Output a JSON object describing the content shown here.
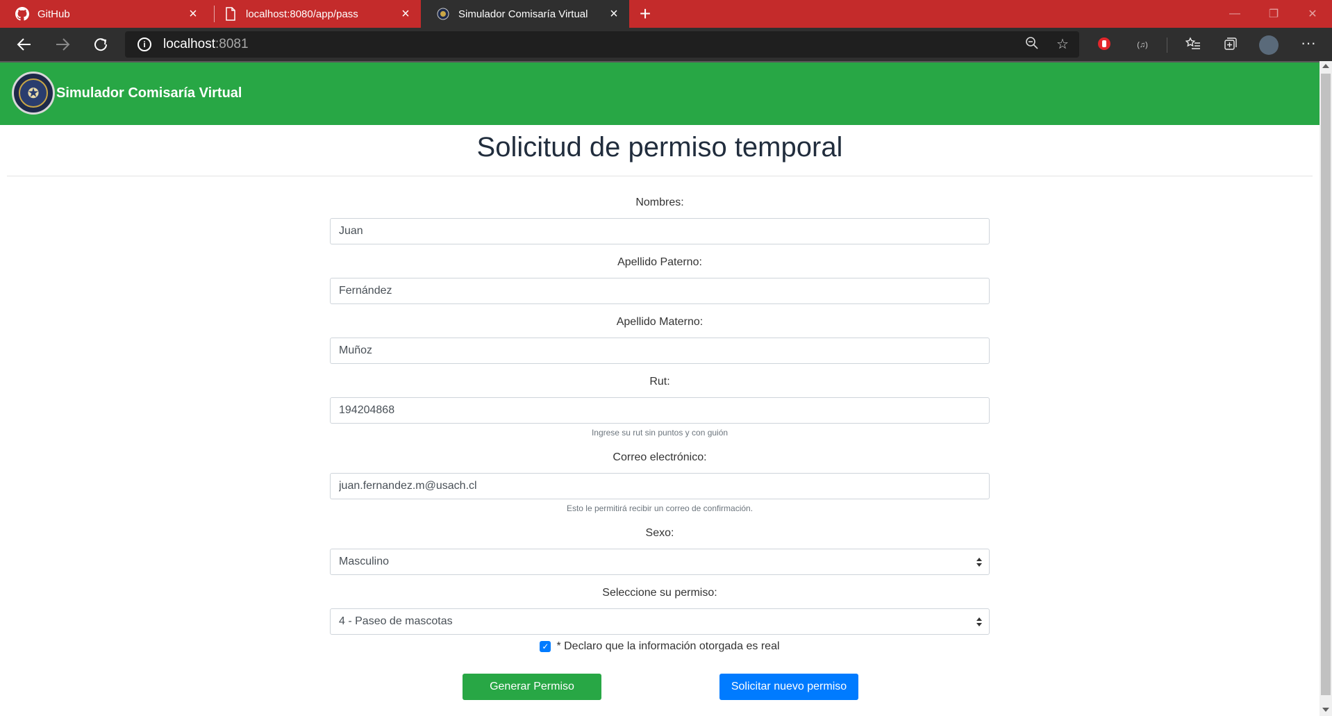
{
  "browser": {
    "tabs": [
      {
        "title": "GitHub",
        "icon": "github-icon",
        "active": false
      },
      {
        "title": "localhost:8080/app/pass",
        "icon": "page-icon",
        "active": false
      },
      {
        "title": "Simulador Comisaría Virtual",
        "icon": "site-favicon",
        "active": true
      }
    ],
    "address": {
      "host": "localhost",
      "port": ":8081"
    },
    "theme_color": "#c42b2b"
  },
  "site": {
    "brand": "Simulador Comisaría Virtual",
    "header_color": "#28a745"
  },
  "page": {
    "title": "Solicitud de permiso temporal"
  },
  "form": {
    "nombres": {
      "label": "Nombres:",
      "value": "Juan"
    },
    "apellido_paterno": {
      "label": "Apellido Paterno:",
      "value": "Fernández"
    },
    "apellido_materno": {
      "label": "Apellido Materno:",
      "value": "Muñoz"
    },
    "rut": {
      "label": "Rut:",
      "value": "194204868",
      "hint": "Ingrese su rut sin puntos y con guión"
    },
    "correo": {
      "label": "Correo electrónico:",
      "value": "juan.fernandez.m@usach.cl",
      "hint": "Esto le permitirá recibir un correo de confirmación."
    },
    "sexo": {
      "label": "Sexo:",
      "selected": "Masculino"
    },
    "permiso": {
      "label": "Seleccione su permiso:",
      "selected": "4 - Paseo de mascotas"
    },
    "declaracion": {
      "label": "* Declaro que la información otorgada es real",
      "checked": true
    },
    "generar_label": "Generar Permiso",
    "nuevo_label": "Solicitar nuevo permiso"
  }
}
